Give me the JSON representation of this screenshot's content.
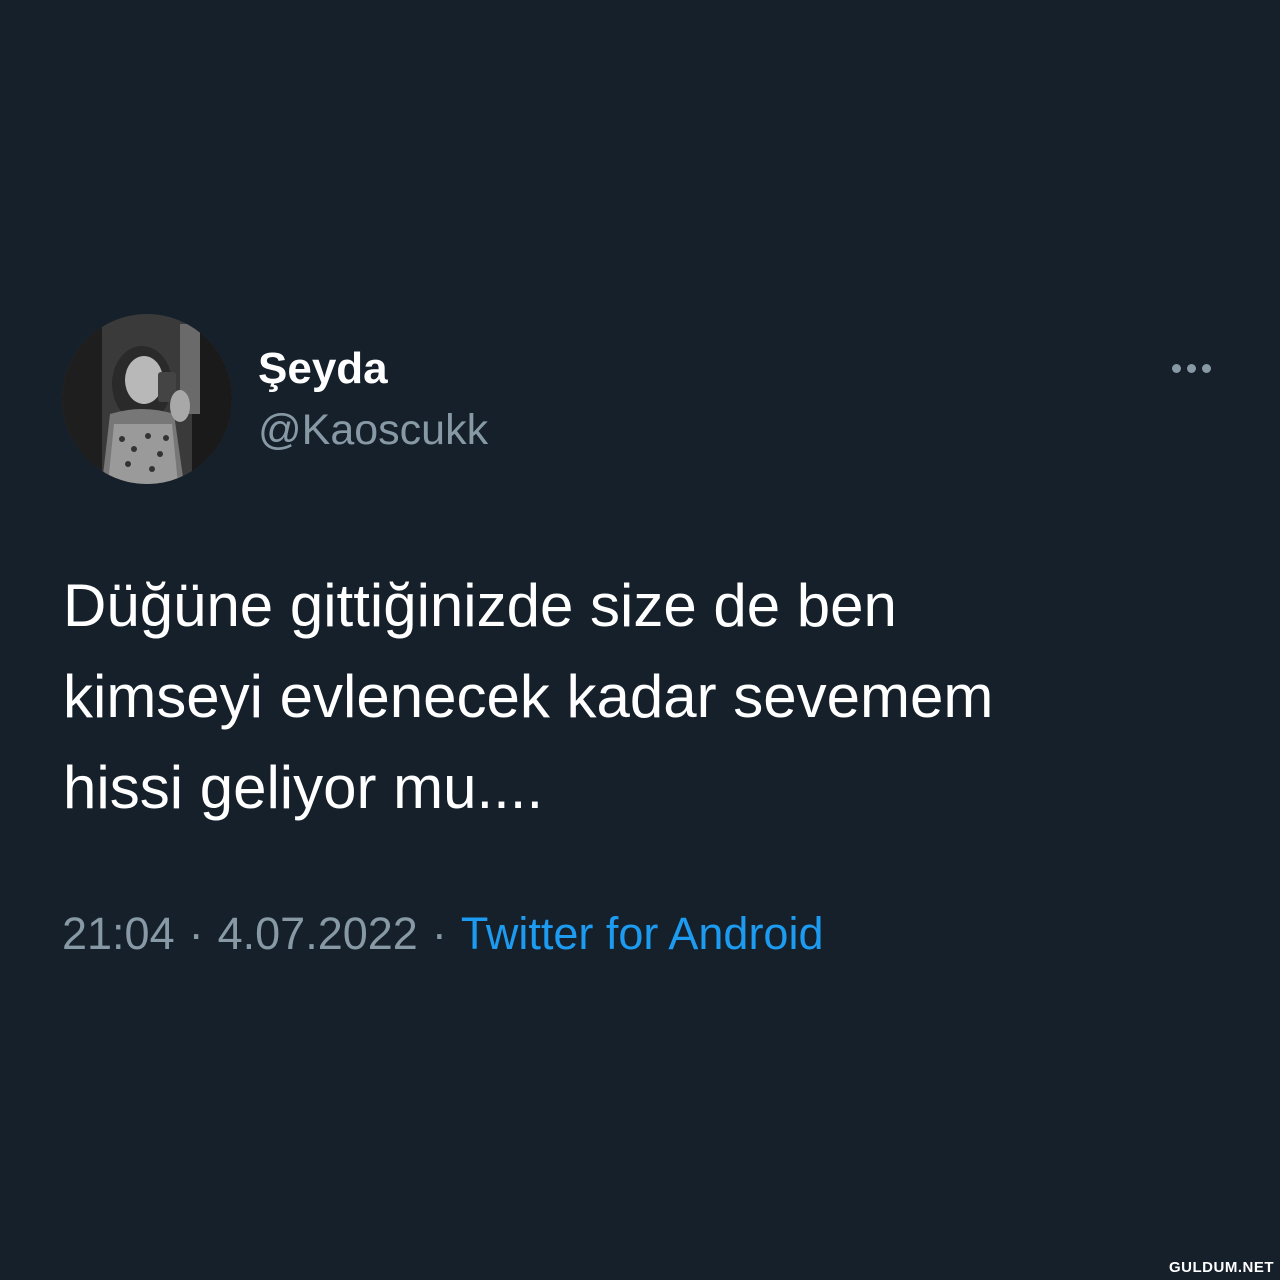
{
  "author": {
    "display_name": "Şeyda",
    "handle": "@Kaoscukk"
  },
  "tweet": {
    "text_lines": [
      "Düğüne gittiğinizde size de ben",
      "kimseyi evlenecek kadar sevemem",
      "hissi geliyor mu...."
    ]
  },
  "meta": {
    "time": "21:04",
    "separator": "·",
    "date": "4.07.2022",
    "source": "Twitter for Android"
  },
  "icons": {
    "more": "more-horizontal-icon",
    "avatar": "profile-photo"
  },
  "watermark": "GULDUM.NET",
  "colors": {
    "background": "#15202b",
    "primary_text": "#ffffff",
    "secondary_text": "#8899a6",
    "link": "#1d9bf0"
  }
}
